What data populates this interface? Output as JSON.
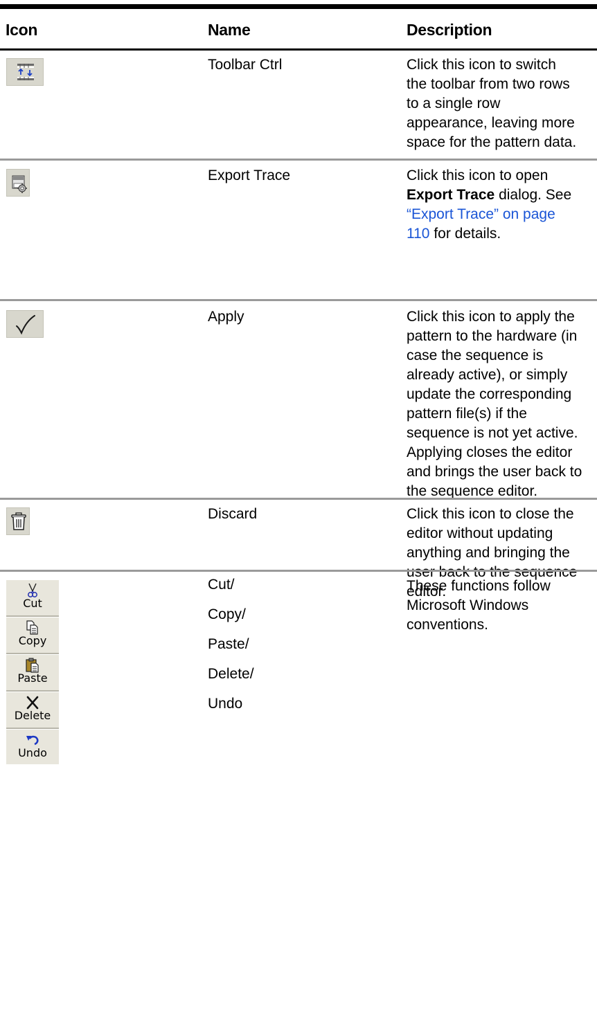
{
  "table": {
    "headers": {
      "icon": "Icon",
      "name": "Name",
      "description": "Description"
    },
    "rows": [
      {
        "icon": "toolbar-ctrl-icon",
        "name": "Toolbar Ctrl",
        "desc_lines": [
          "Click this icon to switch",
          "the toolbar from two rows",
          "to a single row",
          "appearance, leaving more",
          "space for the pattern data."
        ]
      },
      {
        "icon": "export-trace-icon",
        "name": "Export Trace",
        "desc": {
          "l1": "Click this icon to open",
          "l2_bold": "Export Trace",
          "l2_rest": " dialog. See",
          "link_l1": "“Export Trace” on page",
          "link_l2": "110",
          "tail": " for details."
        }
      },
      {
        "icon": "apply-check-icon",
        "name": "Apply",
        "desc_lines": [
          "Click this icon to apply the",
          "pattern to the hardware (in",
          "case the sequence is",
          "already active), or simply",
          "update the corresponding",
          "pattern file(s) if the",
          "sequence is not yet active.",
          "Applying closes the editor",
          "and brings the user back to",
          "the sequence editor."
        ]
      },
      {
        "icon": "trash-icon",
        "name": "Discard",
        "desc_lines": [
          "Click this icon to close the",
          "editor without updating",
          "anything and bringing the",
          "user back to the sequence",
          "editor."
        ]
      },
      {
        "icon": "edit-toolbar-icons",
        "names": [
          "Cut/",
          "Copy/",
          "Paste/",
          "Delete/",
          "Undo"
        ],
        "desc_lines": [
          "These functions follow",
          "Microsoft Windows",
          "conventions."
        ],
        "buttons": [
          "Cut",
          "Copy",
          "Paste",
          "Delete",
          "Undo"
        ]
      }
    ]
  },
  "colors": {
    "link": "#1a55d6",
    "icon_bg": "#d8d7cd",
    "rule": "#9a9a9a"
  }
}
